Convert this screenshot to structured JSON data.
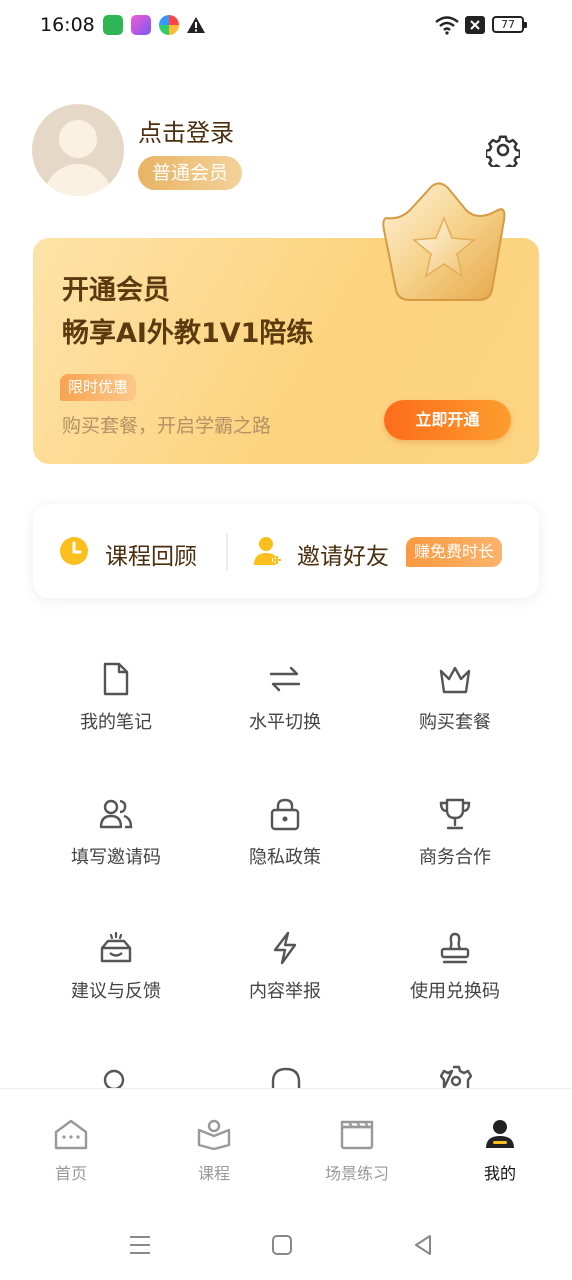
{
  "status_bar": {
    "time": "16:08",
    "battery": "77"
  },
  "profile": {
    "login_text": "点击登录",
    "member_badge": "普通会员"
  },
  "banner": {
    "title_line1": "开通会员",
    "title_line2": "畅享AI外教1V1陪练",
    "tag": "限时优惠",
    "subtitle": "购买套餐，开启学霸之路",
    "button": "立即开通"
  },
  "quick": {
    "review_label": "课程回顾",
    "invite_label": "邀请好友",
    "invite_tag": "赚免费时长"
  },
  "grid": [
    {
      "label": "我的笔记",
      "icon": "note-icon"
    },
    {
      "label": "水平切换",
      "icon": "switch-icon"
    },
    {
      "label": "购买套餐",
      "icon": "crown-icon"
    },
    {
      "label": "填写邀请码",
      "icon": "users-icon"
    },
    {
      "label": "隐私政策",
      "icon": "lock-icon"
    },
    {
      "label": "商务合作",
      "icon": "trophy-icon"
    },
    {
      "label": "建议与反馈",
      "icon": "feedback-box-icon"
    },
    {
      "label": "内容举报",
      "icon": "lightning-icon"
    },
    {
      "label": "使用兑换码",
      "icon": "stamp-icon"
    }
  ],
  "tabs": [
    {
      "label": "首页",
      "icon": "home-icon"
    },
    {
      "label": "课程",
      "icon": "course-icon"
    },
    {
      "label": "场景练习",
      "icon": "clapper-icon"
    },
    {
      "label": "我的",
      "icon": "profile-icon",
      "active": true
    }
  ],
  "colors": {
    "accent": "#fd7a22",
    "banner": "#fdd583",
    "brown_text": "#4a2e0e"
  }
}
